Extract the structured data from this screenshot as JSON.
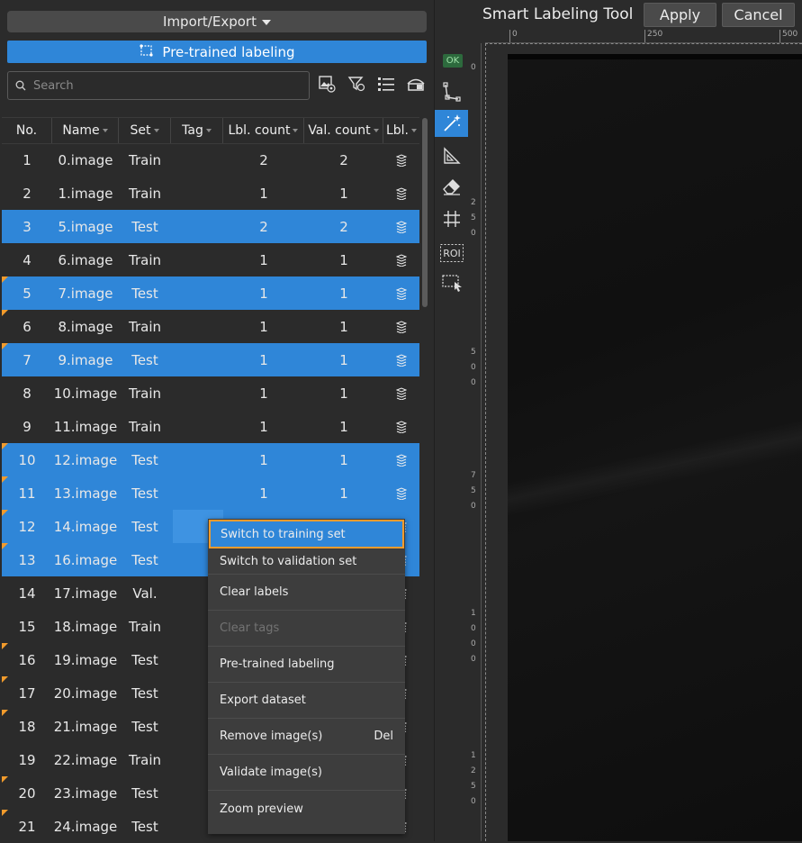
{
  "toolbar": {
    "import_export_label": "Import/Export",
    "pretrained_label": "Pre-trained labeling",
    "search_placeholder": "Search"
  },
  "table": {
    "columns": [
      "No.",
      "Name",
      "Set",
      "Tag",
      "Lbl. count",
      "Val. count",
      "Lbl."
    ],
    "rows": [
      {
        "no": "1",
        "name": "0.image",
        "set": "Train",
        "tag": "",
        "lbl": "2",
        "val": "2",
        "selected": false,
        "flag": false
      },
      {
        "no": "2",
        "name": "1.image",
        "set": "Train",
        "tag": "",
        "lbl": "1",
        "val": "1",
        "selected": false,
        "flag": false
      },
      {
        "no": "3",
        "name": "5.image",
        "set": "Test",
        "tag": "",
        "lbl": "2",
        "val": "2",
        "selected": true,
        "flag": false
      },
      {
        "no": "4",
        "name": "6.image",
        "set": "Train",
        "tag": "",
        "lbl": "1",
        "val": "1",
        "selected": false,
        "flag": false
      },
      {
        "no": "5",
        "name": "7.image",
        "set": "Test",
        "tag": "",
        "lbl": "1",
        "val": "1",
        "selected": true,
        "flag": true
      },
      {
        "no": "6",
        "name": "8.image",
        "set": "Train",
        "tag": "",
        "lbl": "1",
        "val": "1",
        "selected": false,
        "flag": true
      },
      {
        "no": "7",
        "name": "9.image",
        "set": "Test",
        "tag": "",
        "lbl": "1",
        "val": "1",
        "selected": true,
        "flag": true
      },
      {
        "no": "8",
        "name": "10.image",
        "set": "Train",
        "tag": "",
        "lbl": "1",
        "val": "1",
        "selected": false,
        "flag": false
      },
      {
        "no": "9",
        "name": "11.image",
        "set": "Train",
        "tag": "",
        "lbl": "1",
        "val": "1",
        "selected": false,
        "flag": false
      },
      {
        "no": "10",
        "name": "12.image",
        "set": "Test",
        "tag": "",
        "lbl": "1",
        "val": "1",
        "selected": true,
        "flag": true
      },
      {
        "no": "11",
        "name": "13.image",
        "set": "Test",
        "tag": "",
        "lbl": "1",
        "val": "1",
        "selected": true,
        "flag": true
      },
      {
        "no": "12",
        "name": "14.image",
        "set": "Test",
        "tag": "",
        "lbl": "",
        "val": "",
        "selected": true,
        "flag": true
      },
      {
        "no": "13",
        "name": "16.image",
        "set": "Test",
        "tag": "",
        "lbl": "",
        "val": "",
        "selected": true,
        "flag": true
      },
      {
        "no": "14",
        "name": "17.image",
        "set": "Val.",
        "tag": "",
        "lbl": "",
        "val": "",
        "selected": false,
        "flag": false
      },
      {
        "no": "15",
        "name": "18.image",
        "set": "Train",
        "tag": "",
        "lbl": "",
        "val": "",
        "selected": false,
        "flag": false
      },
      {
        "no": "16",
        "name": "19.image",
        "set": "Test",
        "tag": "",
        "lbl": "",
        "val": "",
        "selected": false,
        "flag": true
      },
      {
        "no": "17",
        "name": "20.image",
        "set": "Test",
        "tag": "",
        "lbl": "",
        "val": "",
        "selected": false,
        "flag": true
      },
      {
        "no": "18",
        "name": "21.image",
        "set": "Test",
        "tag": "",
        "lbl": "",
        "val": "",
        "selected": false,
        "flag": true
      },
      {
        "no": "19",
        "name": "22.image",
        "set": "Train",
        "tag": "",
        "lbl": "",
        "val": "",
        "selected": false,
        "flag": false
      },
      {
        "no": "20",
        "name": "23.image",
        "set": "Test",
        "tag": "",
        "lbl": "",
        "val": "",
        "selected": false,
        "flag": true
      },
      {
        "no": "21",
        "name": "24.image",
        "set": "Test",
        "tag": "",
        "lbl": "",
        "val": "",
        "selected": false,
        "flag": true
      }
    ]
  },
  "context_menu": {
    "items": [
      {
        "label": "Switch to training set",
        "shortcut": "",
        "disabled": false,
        "highlighted": true
      },
      {
        "label": "Switch to validation set",
        "shortcut": "",
        "disabled": false,
        "highlighted": false
      },
      {
        "label": "Clear labels",
        "shortcut": "",
        "disabled": false,
        "highlighted": false
      },
      {
        "label": "Clear tags",
        "shortcut": "",
        "disabled": true,
        "highlighted": false
      },
      {
        "label": "Pre-trained labeling",
        "shortcut": "",
        "disabled": false,
        "highlighted": false
      },
      {
        "label": "Export dataset",
        "shortcut": "",
        "disabled": false,
        "highlighted": false
      },
      {
        "label": "Remove image(s)",
        "shortcut": "Del",
        "disabled": false,
        "highlighted": false
      },
      {
        "label": "Validate image(s)",
        "shortcut": "",
        "disabled": false,
        "highlighted": false
      },
      {
        "label": "Zoom preview",
        "shortcut": "",
        "disabled": false,
        "highlighted": false
      }
    ]
  },
  "vertical_tools": {
    "ok_badge": "OK",
    "roi_label": "ROI"
  },
  "labeling": {
    "title": "Smart Labeling Tool",
    "apply_label": "Apply",
    "cancel_label": "Cancel",
    "hruler_labels": [
      "0",
      "250",
      "500"
    ],
    "vruler_groups": [
      [
        "0"
      ],
      [
        "2",
        "5",
        "0"
      ],
      [
        "5",
        "0",
        "0"
      ],
      [
        "7",
        "5",
        "0"
      ],
      [
        "1",
        "0",
        "0",
        "0"
      ],
      [
        "1",
        "2",
        "5",
        "0"
      ]
    ]
  },
  "colors": {
    "accent": "#2f86d8",
    "highlight_border": "#f29b2c",
    "flag": "#f29b2c",
    "background": "#2b2b2b"
  }
}
